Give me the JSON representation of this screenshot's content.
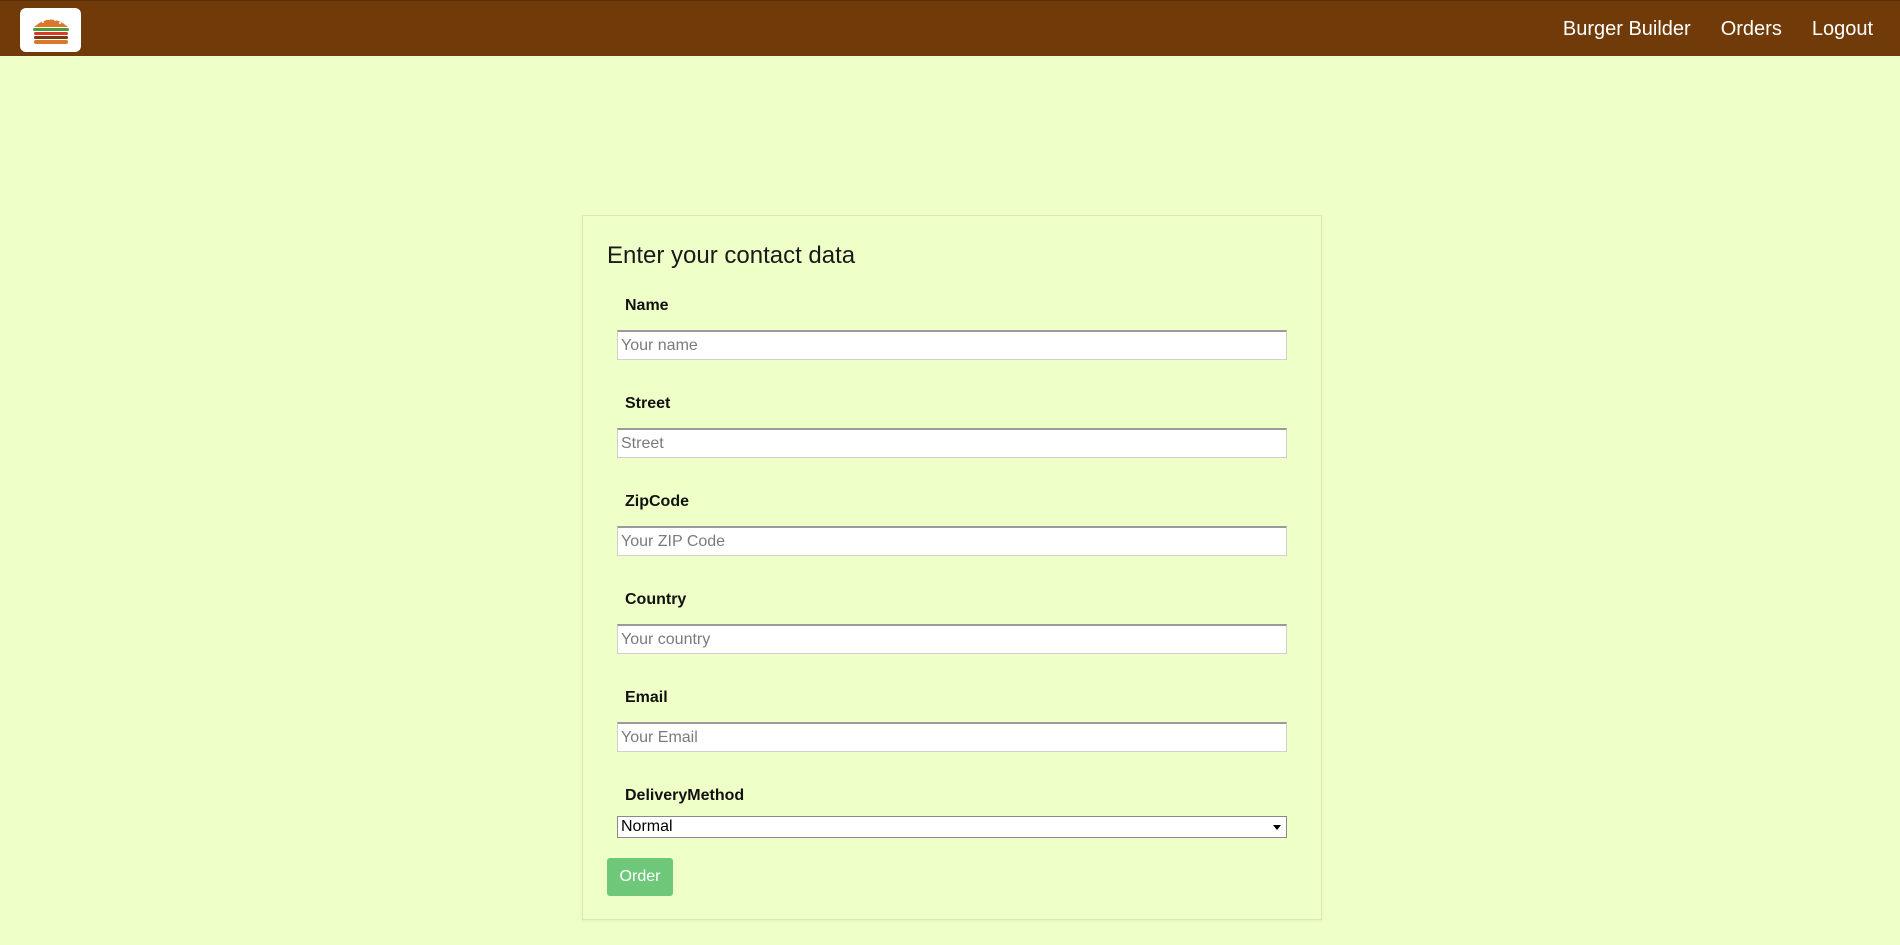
{
  "nav": {
    "logo_icon": "burger-logo-icon",
    "items": [
      "Burger Builder",
      "Orders",
      "Logout"
    ]
  },
  "form": {
    "title": "Enter your contact data",
    "fields": [
      {
        "label": "Name",
        "placeholder": "Your name",
        "value": ""
      },
      {
        "label": "Street",
        "placeholder": "Street",
        "value": ""
      },
      {
        "label": "ZipCode",
        "placeholder": "Your ZIP Code",
        "value": ""
      },
      {
        "label": "Country",
        "placeholder": "Your country",
        "value": ""
      },
      {
        "label": "Email",
        "placeholder": "Your Email",
        "value": ""
      }
    ],
    "delivery": {
      "label": "DeliveryMethod",
      "selected": "Normal"
    },
    "order_label": "Order"
  },
  "colors": {
    "toolbar": "#703b09",
    "background": "#eeffc7",
    "order_button": "#6fc87a"
  }
}
